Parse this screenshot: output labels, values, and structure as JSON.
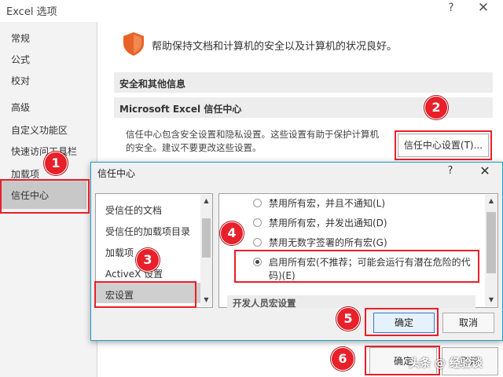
{
  "window": {
    "title": "Excel 选项",
    "help_glyph": "?",
    "close_glyph": "✕"
  },
  "nav": {
    "items": [
      "常规",
      "公式",
      "校对",
      "高级",
      "自定义功能区",
      "快速访问工具栏",
      "加载项",
      "信任中心"
    ],
    "selected": "信任中心"
  },
  "main": {
    "header_message": "帮助保持文档和计算机的安全以及计算机的状况良好。",
    "section_other": "安全和其他信息",
    "section_trust": "Microsoft Excel 信任中心",
    "description_line1": "信任中心包含安全设置和隐私设置。这些设置有助于保护计算机",
    "description_line2": "的安全。建议不要更改这些设置。",
    "trust_settings_button": "信任中心设置(T)..."
  },
  "dialog": {
    "title": "信任中心",
    "help_glyph": "?",
    "close_glyph": "✕",
    "list_items": [
      "受信任的文档",
      "受信任的加载项目录",
      "加载项",
      "ActiveX 设置",
      "宏设置"
    ],
    "selected": "宏设置",
    "options": [
      {
        "label": "禁用所有宏，并且不通知(L)",
        "selected": false
      },
      {
        "label": "禁用所有宏，并发出通知(D)",
        "selected": false
      },
      {
        "label": "禁用无数字签署的所有宏(G)",
        "selected": false
      },
      {
        "label_line1": "启用所有宏(不推荐；可能会运行有潜在危险的代",
        "label_line2": "码)(E)",
        "selected": true
      }
    ],
    "developer_section": "开发人员宏设置",
    "ok_button": "确定",
    "cancel_button": "取消"
  },
  "outer_buttons": {
    "ok": "确定",
    "cancel": "取消"
  },
  "badges": [
    "1",
    "2",
    "3",
    "4",
    "5",
    "6"
  ],
  "watermark": "头条 @ 经验谈",
  "colors": {
    "highlight_red": "#e8202a",
    "dialog_border": "#19a0c8",
    "ok_border": "#2f7bd6"
  }
}
